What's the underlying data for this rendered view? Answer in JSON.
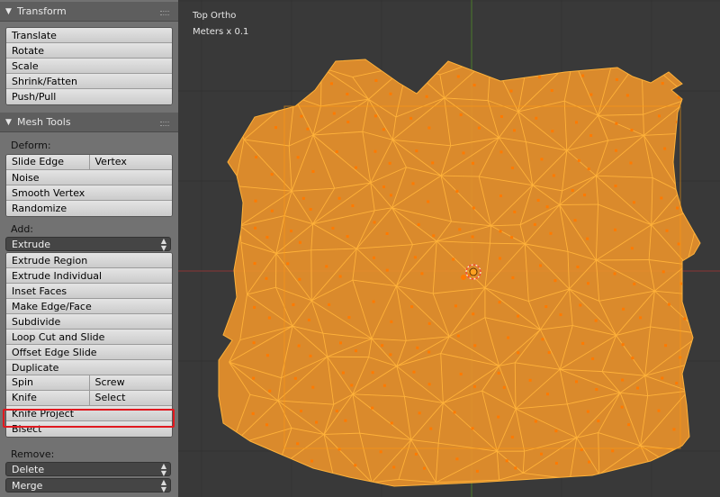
{
  "transform_panel": {
    "title": "Transform",
    "buttons": [
      "Translate",
      "Rotate",
      "Scale",
      "Shrink/Fatten",
      "Push/Pull"
    ]
  },
  "mesh_tools_panel": {
    "title": "Mesh Tools",
    "deform": {
      "label": "Deform:",
      "slide_edge": "Slide Edge",
      "vertex": "Vertex",
      "buttons": [
        "Noise",
        "Smooth Vertex",
        "Randomize"
      ]
    },
    "add": {
      "label": "Add:",
      "extrude_select": "Extrude",
      "buttons": [
        "Extrude Region",
        "Extrude Individual",
        "Inset Faces",
        "Make Edge/Face",
        "Subdivide",
        "Loop Cut and Slide",
        "Offset Edge Slide",
        "Duplicate"
      ],
      "spin": "Spin",
      "screw": "Screw",
      "knife": "Knife",
      "select": "Select",
      "knife_project": "Knife Project",
      "bisect": "Bisect"
    },
    "remove": {
      "label": "Remove:",
      "delete_select": "Delete",
      "merge_select": "Merge"
    }
  },
  "viewport": {
    "view_name": "Top Ortho",
    "units": "Meters x 0.1",
    "colors": {
      "background": "#393939",
      "mesh_face": "#e8912b",
      "mesh_edge": "#ffb23a",
      "vertex_dot": "#ff7a00",
      "x_axis": "#8a3535",
      "y_axis": "#4c7a2a"
    }
  }
}
